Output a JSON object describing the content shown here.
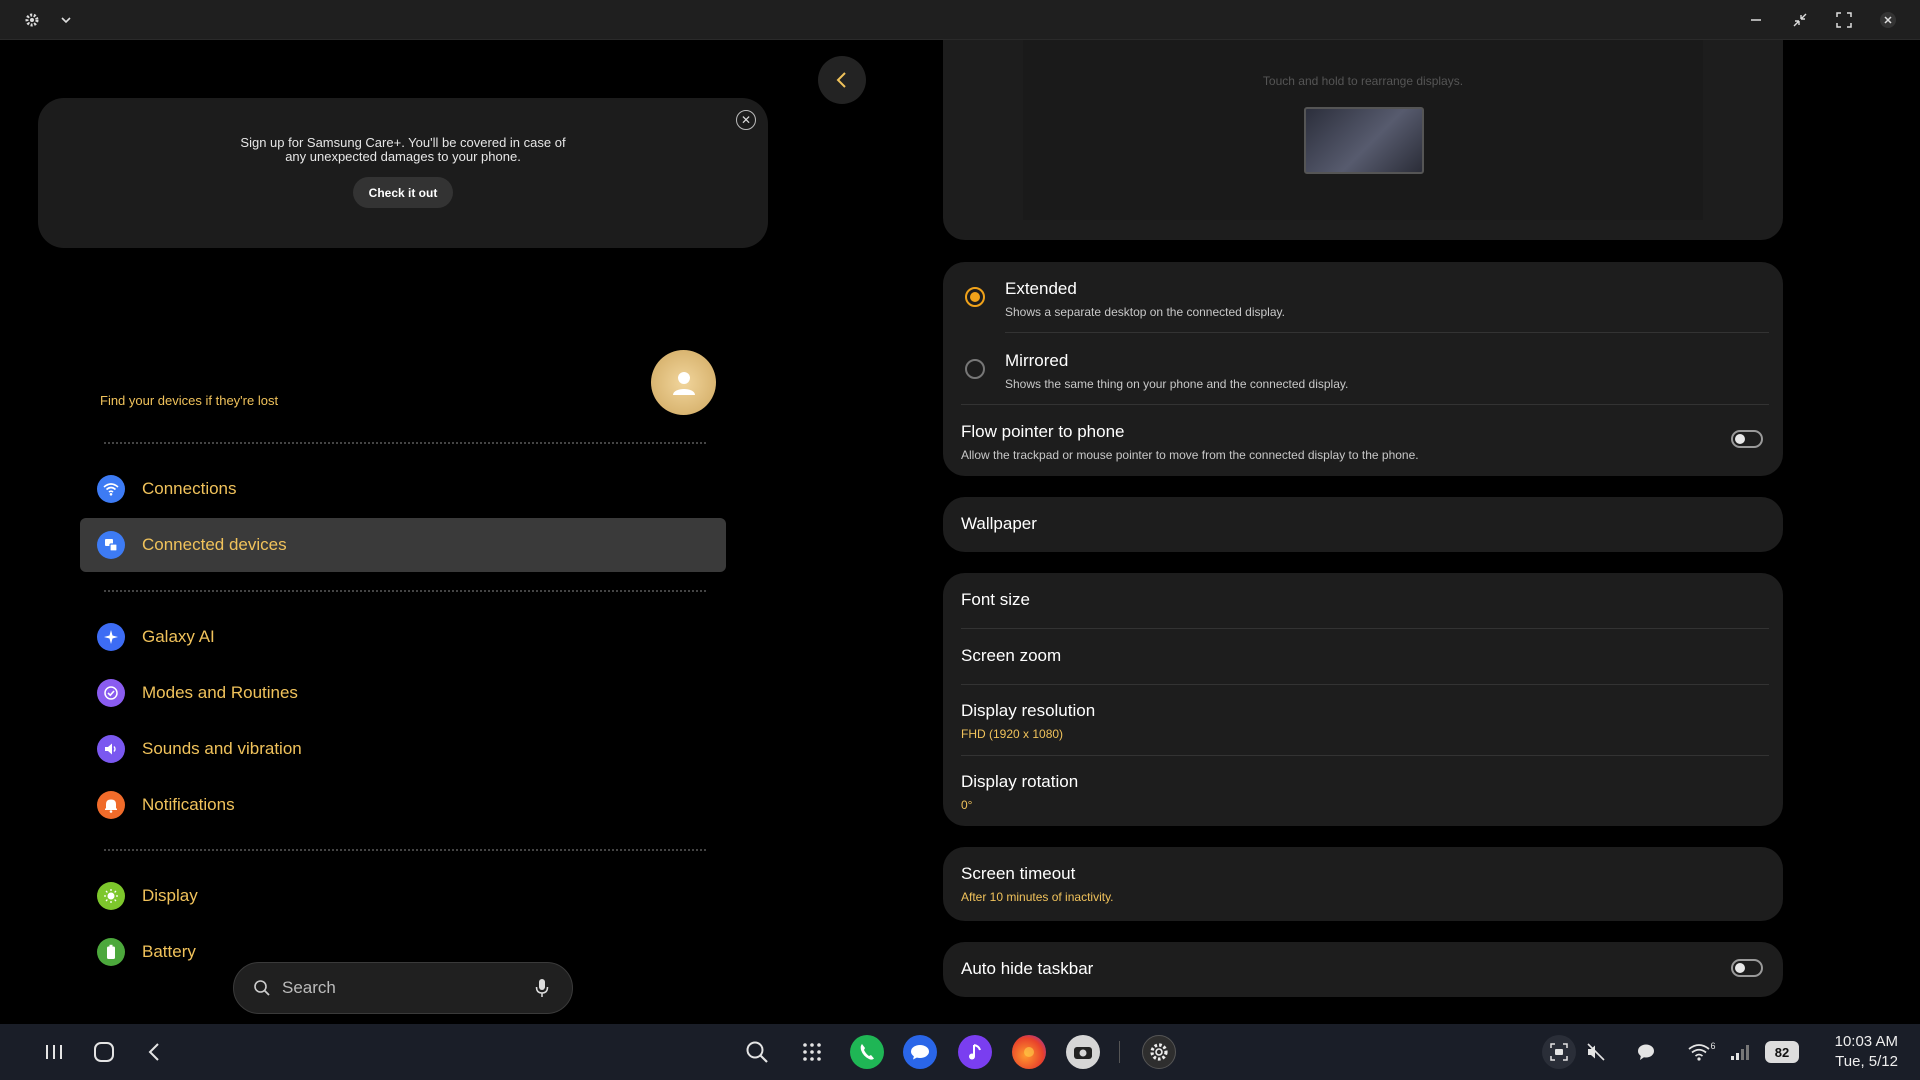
{
  "careplus": {
    "message": "Sign up for Samsung Care+. You'll be covered in case of any unexpected damages to your phone.",
    "button": "Check it out"
  },
  "account": {
    "find_text": "Find your devices if they're lost"
  },
  "menu": {
    "items": [
      {
        "label": "Connections",
        "icon": "wifi-icon",
        "color": "#3d7bf4"
      },
      {
        "label": "Connected devices",
        "icon": "devices-icon",
        "color": "#3d7bf4",
        "active": true
      },
      {
        "label": "Galaxy AI",
        "icon": "sparkle-icon",
        "color": "#3d6cf4"
      },
      {
        "label": "Modes and Routines",
        "icon": "check-circle-icon",
        "color": "#8a5cf0"
      },
      {
        "label": "Sounds and vibration",
        "icon": "speaker-icon",
        "color": "#7a58f0"
      },
      {
        "label": "Notifications",
        "icon": "bell-icon",
        "color": "#f06b2a"
      },
      {
        "label": "Display",
        "icon": "sun-icon",
        "color": "#7dc72c"
      },
      {
        "label": "Battery",
        "icon": "battery-icon",
        "color": "#4ca83c"
      }
    ]
  },
  "search": {
    "placeholder": "Search"
  },
  "display_settings": {
    "preview_hint": "Touch and hold to rearrange displays.",
    "mode": {
      "extended_title": "Extended",
      "extended_sub": "Shows a separate desktop on the connected display.",
      "mirrored_title": "Mirrored",
      "mirrored_sub": "Shows the same thing on your phone and the connected display.",
      "selected": "Extended"
    },
    "flow_pointer": {
      "title": "Flow pointer to phone",
      "sub": "Allow the trackpad or mouse pointer to move from the connected display to the phone.",
      "enabled": false
    },
    "wallpaper": "Wallpaper",
    "font_size": "Font size",
    "screen_zoom": "Screen zoom",
    "resolution": {
      "title": "Display resolution",
      "value": "FHD (1920 x 1080)"
    },
    "rotation": {
      "title": "Display rotation",
      "value": "0°"
    },
    "timeout": {
      "title": "Screen timeout",
      "value": "After 10 minutes of inactivity."
    },
    "auto_hide": {
      "title": "Auto hide taskbar",
      "enabled": false
    }
  },
  "taskbar": {
    "time": "10:03 AM",
    "date": "Tue, 5/12",
    "battery": "82",
    "wifi_badge": "6"
  },
  "colors": {
    "accent": "#f0c25b",
    "radio_on": "#f0a21a"
  }
}
